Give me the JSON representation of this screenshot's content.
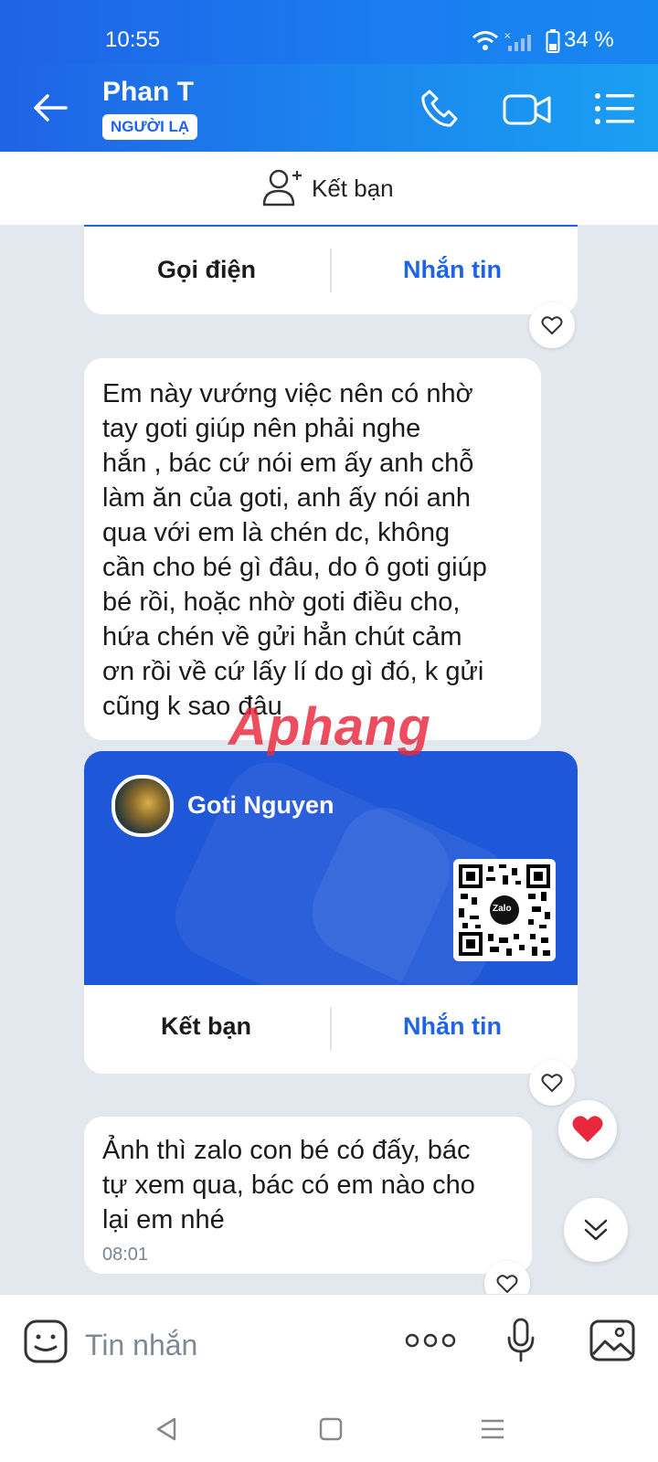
{
  "status_bar": {
    "time": "10:55",
    "battery": "34 %"
  },
  "header": {
    "name": "Phan T",
    "badge": "NGƯỜI LẠ"
  },
  "add_friend_bar": {
    "label": "Kết bạn"
  },
  "card1": {
    "left_button": "Gọi điện",
    "right_button": "Nhắn tin"
  },
  "message1": {
    "lines": [
      "Em này vướng việc nên có nhờ",
      "tay goti  giúp nên phải nghe",
      "hắn , bác cứ nói em ấy anh chỗ",
      "làm ăn của goti, anh ấy nói anh",
      "qua với em là chén dc, không",
      "cần cho bé gì đâu, do ô goti giúp",
      "bé rồi, hoặc nhờ goti điều cho,",
      "hứa chén về gửi hẳn chút cảm",
      "ơn rồi về cứ lấy lí do gì đó, k gửi",
      "cũng k sao đâu"
    ]
  },
  "watermark": "Aphang",
  "contact_card": {
    "name": "Goti Nguyen",
    "qr_logo": "Zalo",
    "left_button": "Kết bạn",
    "right_button": "Nhắn tin"
  },
  "message2": {
    "lines": [
      "Ảnh thì zalo con bé có đấy, bác",
      "tự xem qua, bác có em nào cho",
      "lại em nhé"
    ],
    "time": "08:01"
  },
  "input": {
    "placeholder": "Tin nhắn"
  },
  "colors": {
    "primary": "#1f63e6",
    "card_blue": "#1f57d9",
    "background": "#e3e8ee",
    "heart": "#e8283c"
  },
  "icons": [
    "back-arrow-icon",
    "phone-icon",
    "video-call-icon",
    "menu-list-icon",
    "add-friend-icon",
    "heart-outline-icon",
    "heart-filled-icon",
    "scroll-down-icon",
    "emoji-icon",
    "more-icon",
    "microphone-icon",
    "image-icon",
    "nav-back-icon",
    "nav-home-icon",
    "nav-recents-icon"
  ]
}
